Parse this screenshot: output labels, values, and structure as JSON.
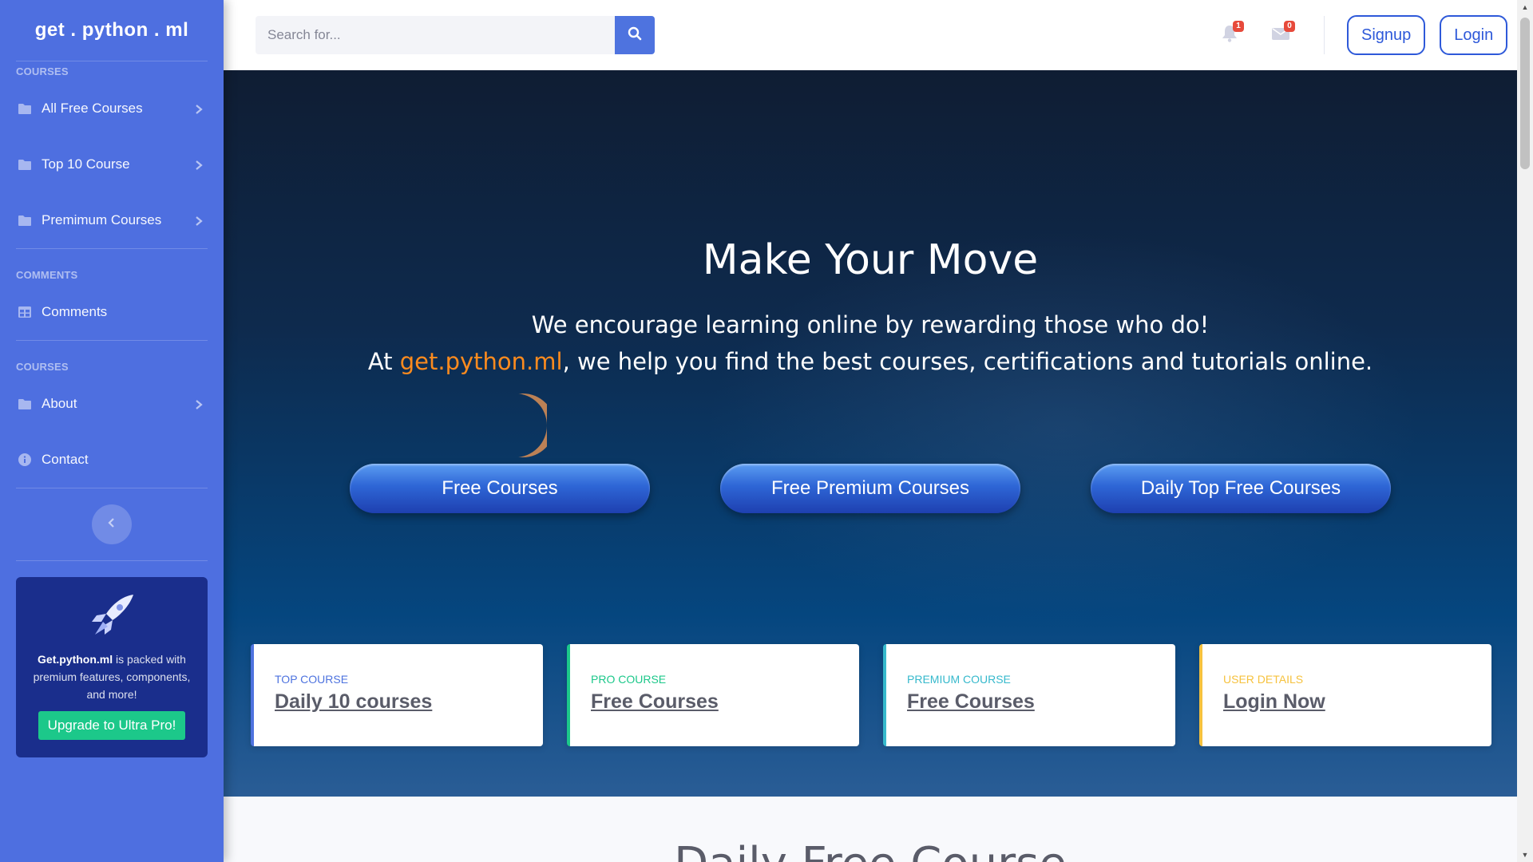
{
  "brand": "get . python . ml",
  "sidebar": {
    "sections": [
      {
        "heading": "COURSES",
        "items": [
          {
            "label": "All Free Courses",
            "icon": "folder-icon",
            "chevron": true
          },
          {
            "label": "Top 10 Course",
            "icon": "folder-icon",
            "chevron": true
          },
          {
            "label": "Premimum Courses",
            "icon": "folder-icon",
            "chevron": true
          }
        ]
      },
      {
        "heading": "COMMENTS",
        "items": [
          {
            "label": "Comments",
            "icon": "table-icon",
            "chevron": false
          }
        ]
      },
      {
        "heading": "COURSES",
        "items": [
          {
            "label": "About",
            "icon": "folder-icon",
            "chevron": true
          },
          {
            "label": "Contact",
            "icon": "info-icon",
            "chevron": false
          }
        ]
      }
    ],
    "promo": {
      "bold": "Get.python.ml",
      "text": " is packed with premium features, components, and more!",
      "button": "Upgrade to Ultra Pro!"
    }
  },
  "topbar": {
    "search_placeholder": "Search for...",
    "alerts_count": "1",
    "messages_count": "0",
    "signup": "Signup",
    "login": "Login"
  },
  "hero": {
    "title": "Make Your Move",
    "line1": "We encourage learning online by rewarding those who do!",
    "line2_prefix": "At ",
    "line2_accent": "get.python.ml",
    "line2_suffix": ", we help you find the best courses, certifications and tutorials online.",
    "ctas": [
      "Free Courses",
      "Free Premium Courses",
      "Daily Top Free Courses"
    ]
  },
  "cards": [
    {
      "kicker": "TOP COURSE",
      "link": "Daily 10 courses",
      "color": "#4e73df"
    },
    {
      "kicker": "PRO COURSE",
      "link": "Free Courses",
      "color": "#1cc88a"
    },
    {
      "kicker": "PREMIUM COURSE",
      "link": "Free Courses",
      "color": "#36b9cc"
    },
    {
      "kicker": "USER DETAILS",
      "link": "Login Now",
      "color": "#f6c23e"
    }
  ],
  "section_title": "Daily Free Course",
  "colors": {
    "sidebar": "#4e6fe0",
    "primary": "#4e73df",
    "accent": "#fd8b1e",
    "success": "#1cc88a"
  }
}
